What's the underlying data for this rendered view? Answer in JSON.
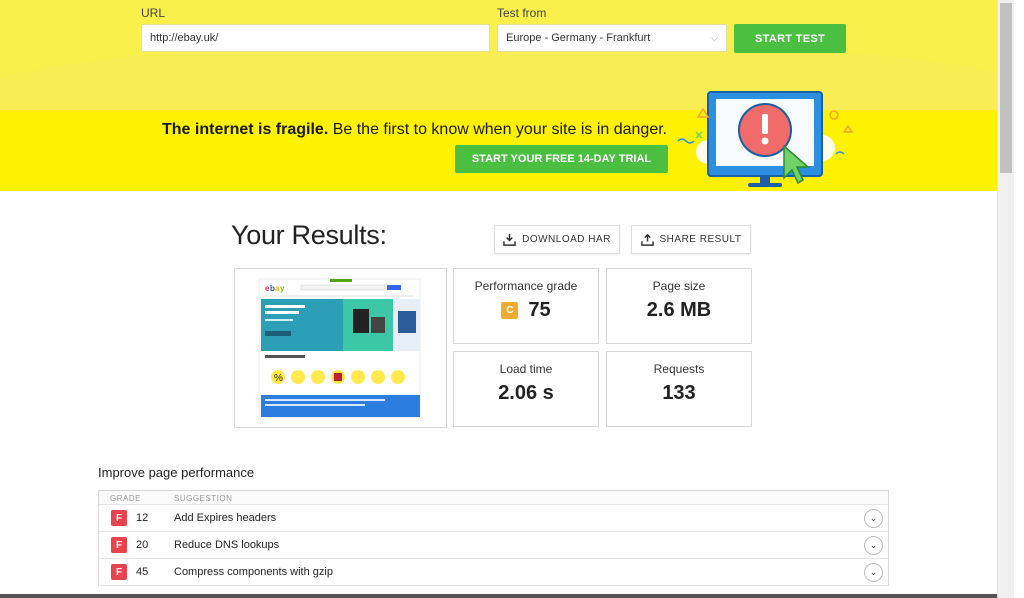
{
  "form": {
    "url_label": "URL",
    "url_value": "http://ebay.uk/",
    "test_from_label": "Test from",
    "test_from_value": "Europe - Germany - Frankfurt",
    "start_button": "START TEST"
  },
  "promo": {
    "bold_text": "The internet is fragile.",
    "text": " Be the first to know when your site is in danger.",
    "trial_button": "START YOUR FREE 14-DAY TRIAL"
  },
  "results": {
    "title": "Your Results:",
    "download_button": "DOWNLOAD HAR",
    "share_button": "SHARE RESULT",
    "performance_grade_label": "Performance grade",
    "performance_grade_letter": "C",
    "performance_grade_value": "75",
    "page_size_label": "Page size",
    "page_size_value": "2.6 MB",
    "load_time_label": "Load time",
    "load_time_value": "2.06 s",
    "requests_label": "Requests",
    "requests_value": "133"
  },
  "improve": {
    "title": "Improve page performance",
    "col_grade": "GRADE",
    "col_suggestion": "SUGGESTION",
    "rows": [
      {
        "grade": "F",
        "score": "12",
        "suggestion": "Add Expires headers"
      },
      {
        "grade": "F",
        "score": "20",
        "suggestion": "Reduce DNS lookups"
      },
      {
        "grade": "F",
        "score": "45",
        "suggestion": "Compress components with gzip"
      }
    ]
  },
  "colors": {
    "yellow_band": "#faf04b",
    "promo_yellow": "#fff200",
    "green_button": "#4bbf3f",
    "grade_c": "#f0ab32",
    "grade_f": "#e8424c"
  }
}
